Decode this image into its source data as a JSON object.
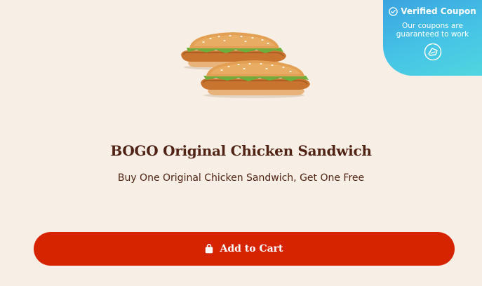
{
  "badge": {
    "title": "Verified Coupon",
    "line1": "Our coupons are",
    "line2": "guaranteed to work"
  },
  "offer": {
    "title": "BOGO Original Chicken Sandwich",
    "description": "Buy One Original Chicken Sandwich, Get One Free"
  },
  "cart": {
    "label": "Add to Cart"
  },
  "colors": {
    "background": "#f7efe5",
    "text": "#502314",
    "button": "#d62300",
    "badge_gradient_start": "#3aa3e0",
    "badge_gradient_end": "#4fd6df"
  },
  "icons": {
    "badge_check": "check-circle-icon",
    "badge_logo": "coupon-brand-icon",
    "cart": "shopping-bag-icon"
  }
}
